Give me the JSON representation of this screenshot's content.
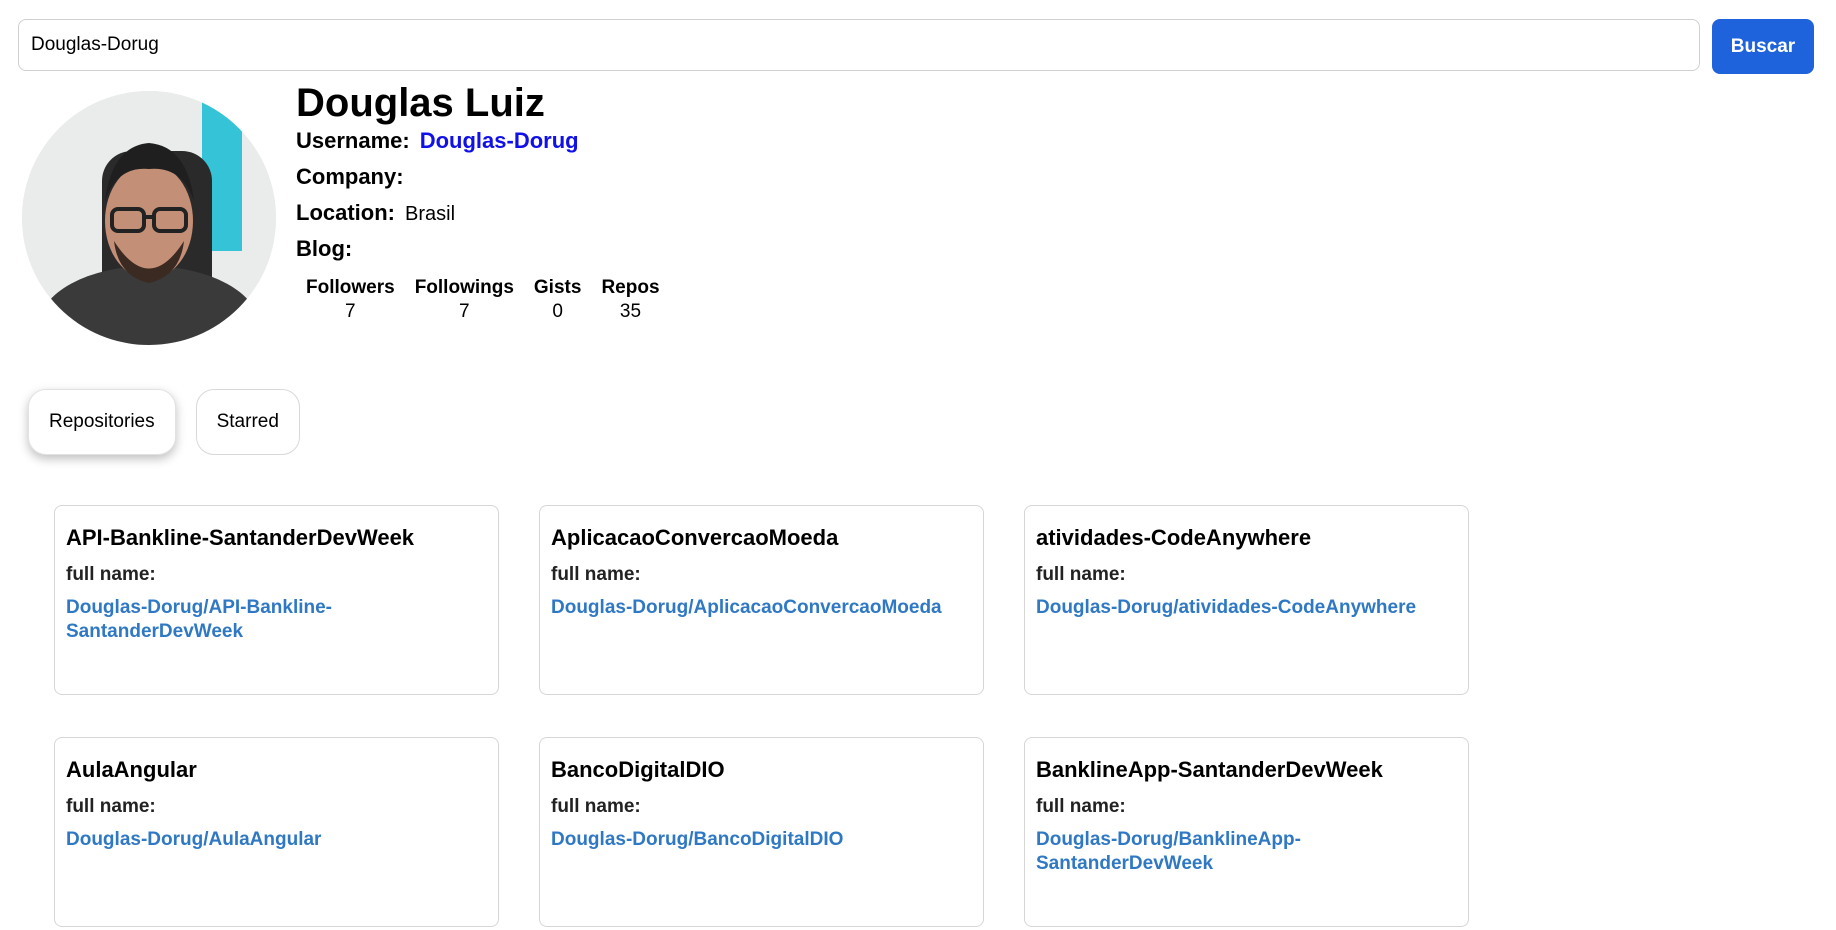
{
  "search": {
    "value": "Douglas-Dorug",
    "button_label": "Buscar"
  },
  "profile": {
    "name": "Douglas Luiz",
    "username_label": "Username:",
    "username": "Douglas-Dorug",
    "company_label": "Company:",
    "company": "",
    "location_label": "Location:",
    "location": "Brasil",
    "blog_label": "Blog:",
    "blog": ""
  },
  "stats": [
    {
      "label": "Followers",
      "value": "7"
    },
    {
      "label": "Followings",
      "value": "7"
    },
    {
      "label": "Gists",
      "value": "0"
    },
    {
      "label": "Repos",
      "value": "35"
    }
  ],
  "tabs": [
    {
      "label": "Repositories",
      "active": true
    },
    {
      "label": "Starred",
      "active": false
    }
  ],
  "repos": [
    {
      "name": "API-Bankline-SantanderDevWeek",
      "full_name_label": "full name:",
      "full_name": "Douglas-Dorug/API-Bankline-SantanderDevWeek"
    },
    {
      "name": "AplicacaoConvercaoMoeda",
      "full_name_label": "full name:",
      "full_name": "Douglas-Dorug/AplicacaoConvercaoMoeda"
    },
    {
      "name": "atividades-CodeAnywhere",
      "full_name_label": "full name:",
      "full_name": "Douglas-Dorug/atividades-CodeAnywhere"
    },
    {
      "name": "AulaAngular",
      "full_name_label": "full name:",
      "full_name": "Douglas-Dorug/AulaAngular"
    },
    {
      "name": "BancoDigitalDIO",
      "full_name_label": "full name:",
      "full_name": "Douglas-Dorug/BancoDigitalDIO"
    },
    {
      "name": "BanklineApp-SantanderDevWeek",
      "full_name_label": "full name:",
      "full_name": "Douglas-Dorug/BanklineApp-SantanderDevWeek"
    }
  ],
  "colors": {
    "accent": "#1f63dc",
    "username_link": "#1010e8",
    "repo_link": "#2f78c4"
  }
}
